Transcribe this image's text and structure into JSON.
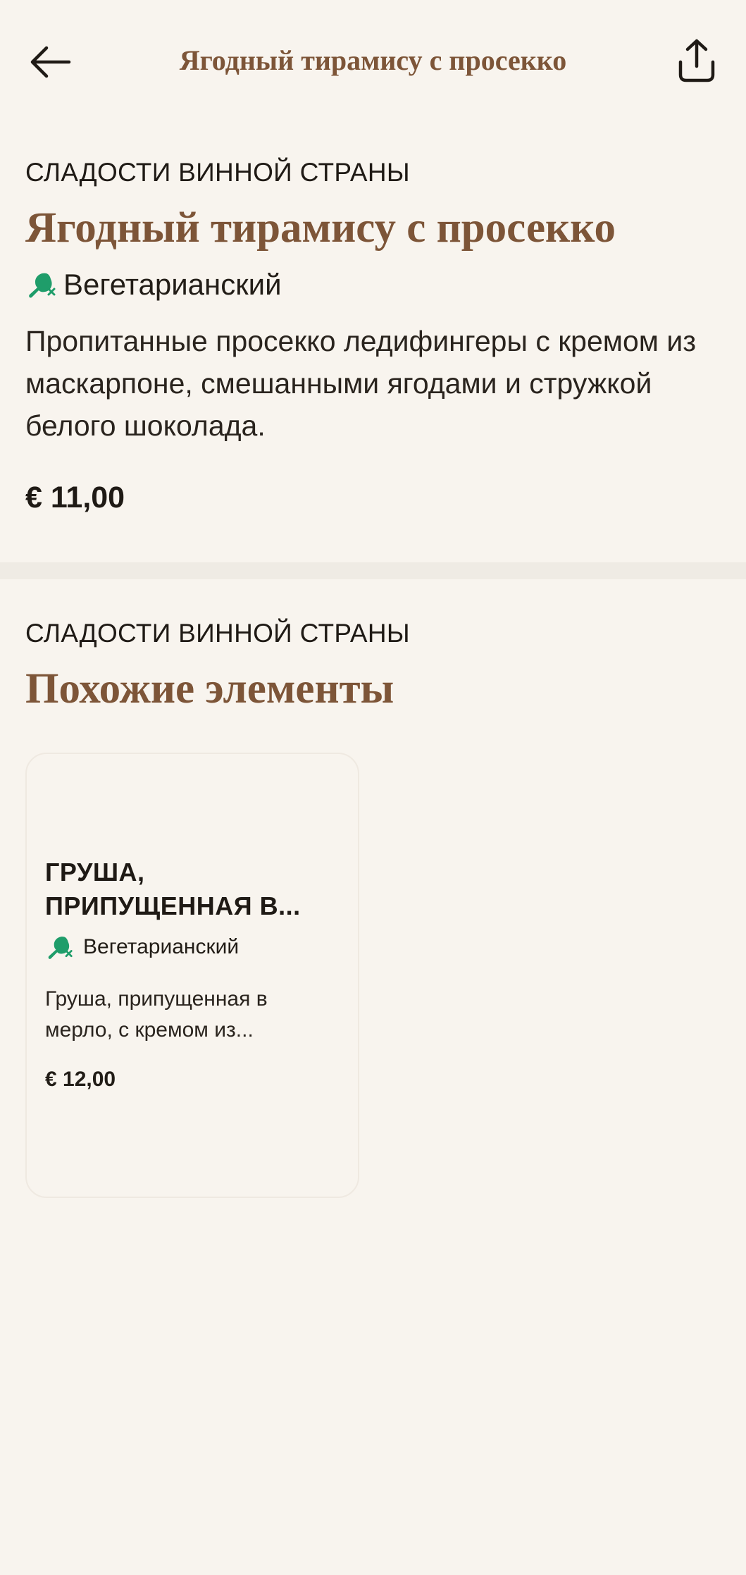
{
  "header": {
    "title": "Ягодный тирамису с просекко",
    "back_icon": "arrow-left-icon",
    "share_icon": "share-icon"
  },
  "item": {
    "category": "СЛАДОСТИ ВИННОЙ СТРАНЫ",
    "title": "Ягодный тирамису с просекко",
    "diet_label": "Вегетарианский",
    "diet_icon": "vegetarian-icon",
    "description": "Пропитанные просекко ледифингеры с кремом из маскарпоне, смешанными ягодами и стружкой белого шоколада.",
    "price": "€ 11,00"
  },
  "similar": {
    "category": "СЛАДОСТИ ВИННОЙ СТРАНЫ",
    "title": "Похожие элементы",
    "cards": [
      {
        "name": "ГРУША, ПРИПУЩЕННАЯ В...",
        "diet_label": "Вегетарианский",
        "description": "Груша, припущенная в мерло, с кремом из...",
        "price": "€ 12,00"
      }
    ]
  },
  "colors": {
    "background": "#f8f4ee",
    "accent_brown": "#7d5538",
    "veg_green": "#1f9d6a",
    "divider": "#efebe4"
  }
}
